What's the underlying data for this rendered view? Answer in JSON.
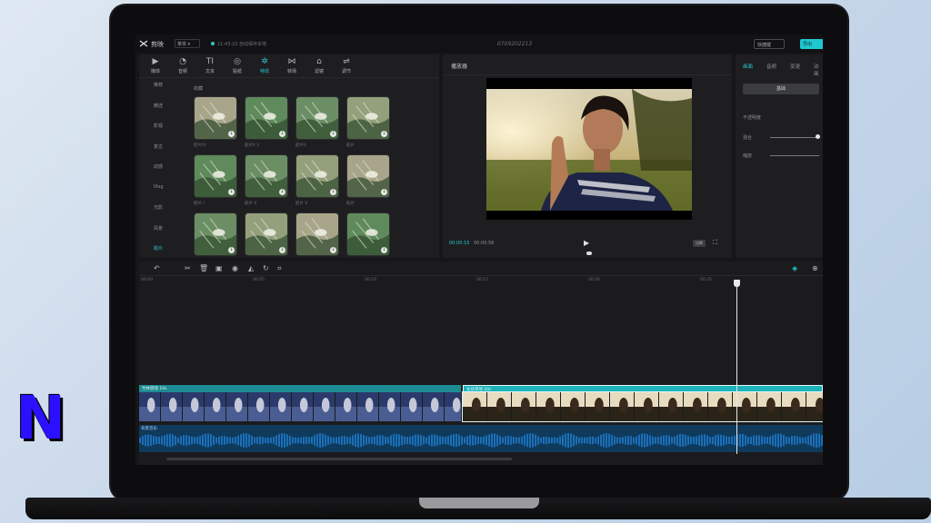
{
  "app": {
    "name": "剪映",
    "menu_label": "菜单 ▾",
    "save_status": "11:43:10 自动保存本地",
    "project_title": "0709202213",
    "shortcut_label": "快捷键",
    "export_label": "导出"
  },
  "tool_tabs": [
    {
      "icon": "▶",
      "label": "媒体"
    },
    {
      "icon": "◔",
      "label": "音频"
    },
    {
      "icon": "TI",
      "label": "文本"
    },
    {
      "icon": "◎",
      "label": "贴纸"
    },
    {
      "icon": "✲",
      "label": "特效"
    },
    {
      "icon": "⋈",
      "label": "转场"
    },
    {
      "icon": "⌂",
      "label": "滤镜"
    },
    {
      "icon": "⇌",
      "label": "调节"
    }
  ],
  "side_categories": [
    "推荐",
    "精选",
    "影视",
    "复古",
    "动感",
    "Vlog",
    "光影",
    "风景",
    "胶片"
  ],
  "active_category_index": 8,
  "section_label": "收藏",
  "filter_thumbnails": [
    {
      "label": "胶片III"
    },
    {
      "label": "胶片II 3"
    },
    {
      "label": "胶片II"
    },
    {
      "label": "胶片"
    },
    {
      "label": "胶片 I"
    },
    {
      "label": "胶片 II"
    },
    {
      "label": "胶片 V"
    },
    {
      "label": "胶片"
    },
    {
      "label": ""
    },
    {
      "label": ""
    },
    {
      "label": ""
    },
    {
      "label": ""
    }
  ],
  "player": {
    "title": "播放器",
    "time_current": "00:00:15",
    "time_total": "00:00:56",
    "ratio_label": "比例"
  },
  "inspector": {
    "tabs": [
      "画面",
      "音频",
      "变速",
      "动画"
    ],
    "active_tab": 0,
    "reset_label": "基础",
    "fields": [
      "不透明度",
      "混合",
      "缩放"
    ]
  },
  "timeline": {
    "ruler_labels": [
      "00:00",
      "00:05",
      "00:10",
      "00:15",
      "00:20",
      "00:25"
    ],
    "clip1_label": "竹林游戏  10s",
    "clip2_label": "女孩草地  20s",
    "audio_label": "背景音乐"
  },
  "colors": {
    "accent": "#29c6cf",
    "audio": "#1b6fb8",
    "video_clip_header": "#1c8b93"
  },
  "watermark_text": "N"
}
